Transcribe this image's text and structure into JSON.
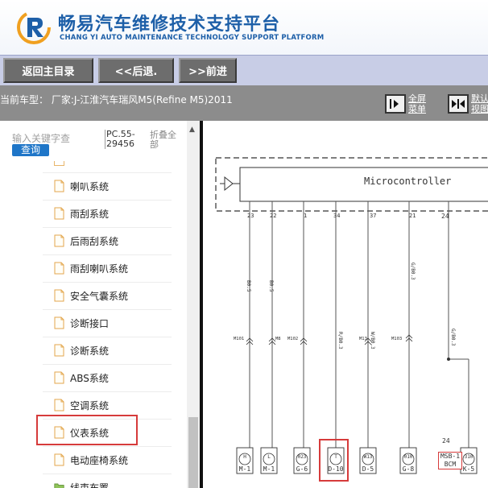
{
  "header": {
    "title_cn": "畅易汽车维修技术支持平台",
    "title_en": "CHANG YI AUTO MAINTENANCE TECHNOLOGY SUPPORT PLATFORM",
    "brand_color": "#1d5fa8"
  },
  "toolbar": {
    "home_label": "返回主目录",
    "back_label": "<<后退.",
    "forward_label": ">>前进"
  },
  "infobar": {
    "vehicle_text": "当前车型：  厂家:J-江淮汽车瑞风M5(Refine M5)2011",
    "fullscreen_line1": "全屏",
    "fullscreen_line2": "菜单",
    "default_line1": "默认",
    "default_line2": "视图"
  },
  "sidebar": {
    "search_placeholder": "输入关键字查",
    "query_label": "查询",
    "pc_code": "PC.55-29456",
    "fold_all": "折叠全部",
    "items": [
      {
        "label": "喇叭系统"
      },
      {
        "label": "雨刮系统"
      },
      {
        "label": "后雨刮系统"
      },
      {
        "label": "雨刮喇叭系统"
      },
      {
        "label": "安全气囊系统"
      },
      {
        "label": "诊断接口"
      },
      {
        "label": "诊断系统"
      },
      {
        "label": "ABS系统"
      },
      {
        "label": "空调系统"
      },
      {
        "label": "仪表系统"
      },
      {
        "label": "电动座椅系统"
      },
      {
        "label": "线束布置"
      }
    ],
    "highlighted_item": "仪表系统",
    "highlight_color": "#d63b3b"
  },
  "diagram": {
    "microcontroller_label": "Microcontroller",
    "pins": [
      "23",
      "22",
      "1",
      "34",
      "37",
      "21",
      "24"
    ],
    "wire_colors": [
      "B0.5",
      "B0.5",
      "R/B0.3",
      "W/B0.3",
      "G/B0.3",
      "G/B0.3"
    ],
    "splices": [
      "M101",
      "M8",
      "M102",
      "M13",
      "M103"
    ],
    "connector_symbols": [
      "H",
      "L",
      "023",
      "T",
      "W13",
      "010",
      "310"
    ],
    "connectors": [
      "M-1",
      "M-1",
      "G-6",
      "D-10",
      "D-5",
      "G-8",
      "K-5"
    ],
    "msb_line1": "MSB-1",
    "msb_line2": "BCM",
    "pin_24_lower": "24"
  }
}
